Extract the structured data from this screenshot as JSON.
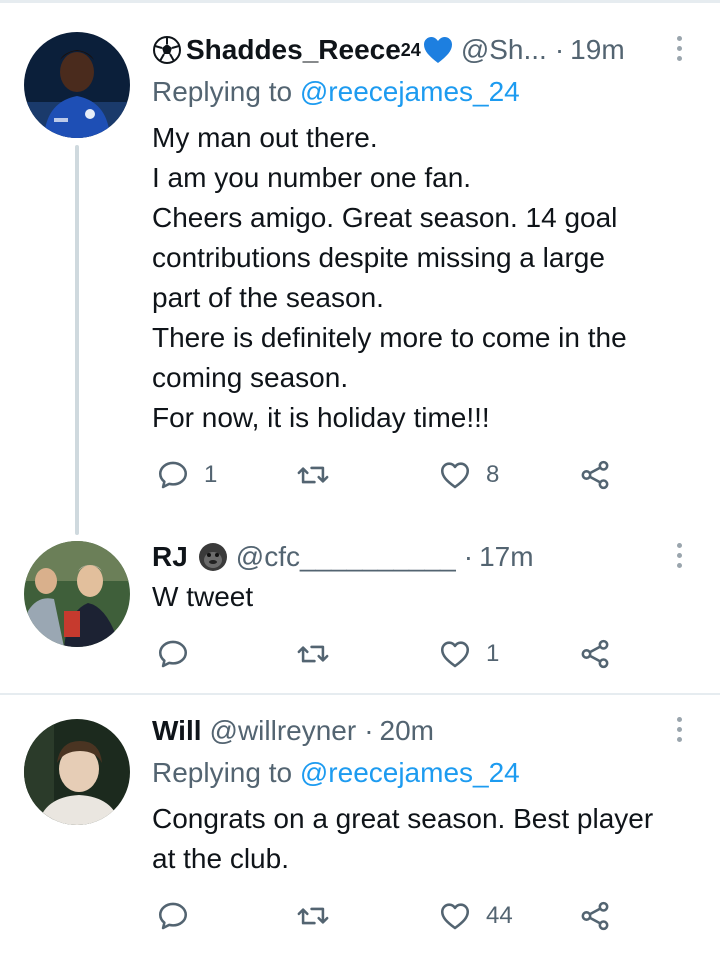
{
  "tweets": [
    {
      "name": "Shaddes_Reece",
      "name_sup": "24",
      "handle": "@Sh...",
      "time": "19m",
      "replying_label": "Replying to",
      "replying_to": "@reecejames_24",
      "lines": [
        "My man out there.",
        "I am you number one fan.",
        "Cheers amigo. Great season. 14 goal",
        "contributions despite missing a large",
        "part of the season.",
        "There is definitely more to come in the",
        "coming season.",
        "For now, it is holiday time!!!"
      ],
      "replies": "1",
      "retweets": "",
      "likes": "8"
    },
    {
      "name": "RJ",
      "handle": "@cfc__________",
      "time": "17m",
      "lines": [
        "W tweet"
      ],
      "replies": "",
      "retweets": "",
      "likes": "1"
    },
    {
      "name": "Will",
      "handle": "@willreyner",
      "time": "20m",
      "replying_label": "Replying to",
      "replying_to": "@reecejames_24",
      "lines": [
        "Congrats on a great season. Best player",
        "at the club."
      ],
      "replies": "",
      "retweets": "",
      "likes": "44"
    }
  ],
  "colors": {
    "link": "#1d9bf0",
    "secondary_text": "#536471",
    "primary_text": "#0f1419",
    "divider": "#e6ecf0"
  },
  "icons": {
    "reply": "reply-icon",
    "retweet": "retweet-icon",
    "like": "heart-icon",
    "share": "share-icon",
    "more": "more-icon"
  }
}
